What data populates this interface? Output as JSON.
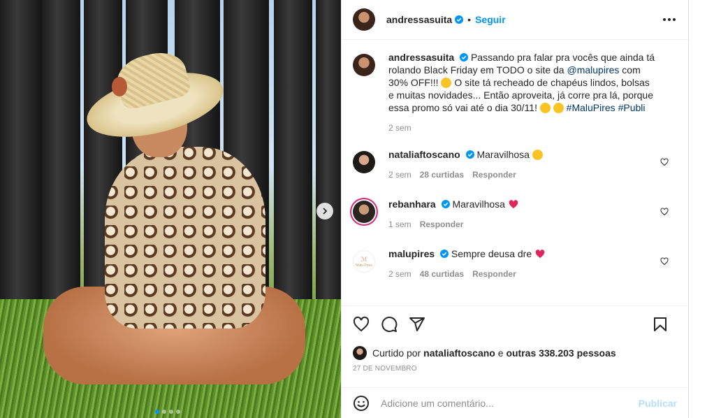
{
  "post": {
    "username": "andressasuita",
    "follow_label": "Seguir",
    "separator": "•"
  },
  "caption": {
    "username": "andressasuita",
    "text_1": "Passando pra falar pra vocês que ainda tá rolando Black Friday em TODO o site da ",
    "mention": "@malupires",
    "text_2": " com 30% OFF!!! ",
    "text_3": " O site tá recheado de chapéus lindos, bolsas e muitas novidades... Então aproveita, já corre pra lá, porque essa promo só vai até o dia 30/11! ",
    "hashtags": "#MaluPires #Publi",
    "time": "2 sem"
  },
  "comments": [
    {
      "username": "nataliaftoscano",
      "text": "Maravilhosa",
      "time": "2 sem",
      "likes": "28 curtidas",
      "reply": "Responder"
    },
    {
      "username": "rebanhara",
      "text": "Maravilhosa",
      "time": "1 sem",
      "reply": "Responder"
    },
    {
      "username": "malupires",
      "text": "Sempre deusa dre",
      "time": "2 sem",
      "likes": "48 curtidas",
      "reply": "Responder"
    }
  ],
  "malu_avatar_text": "Malu Pires",
  "likes": {
    "prefix": "Curtido por",
    "user": "nataliaftoscano",
    "connector": "e",
    "others": "outras 338.203 pessoas"
  },
  "date": "27 DE NOVEMBRO",
  "add_comment": {
    "placeholder": "Adicione um comentário...",
    "publish_label": "Publicar"
  },
  "icons": [
    "verified-badge-icon",
    "more-options-icon",
    "next-arrow-icon",
    "heart-icon",
    "comment-icon",
    "share-icon",
    "bookmark-icon",
    "emoji-icon",
    "star-struck-emoji",
    "wink-emoji",
    "red-heart-emoji"
  ],
  "colors": {
    "link": "#0095f6",
    "mention": "#00376b",
    "meta": "#8e8e8e",
    "publish_disabled": "#b2dffc",
    "text": "#262626"
  },
  "carousel": {
    "slides": 4,
    "active_index": 0
  }
}
